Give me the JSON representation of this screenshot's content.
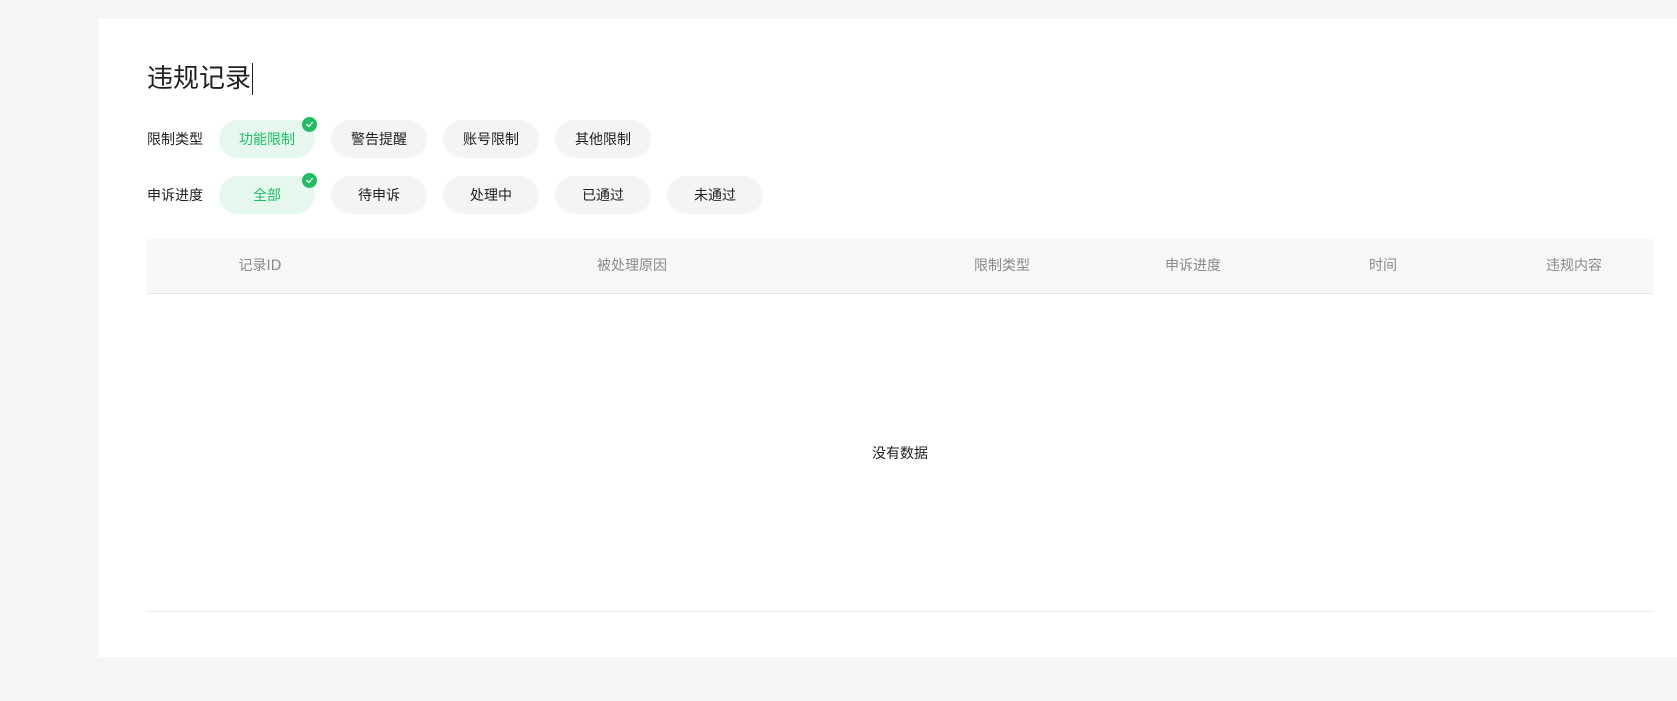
{
  "page": {
    "title": "违规记录"
  },
  "filters": {
    "restriction_type": {
      "label": "限制类型",
      "options": [
        "功能限制",
        "警告提醒",
        "账号限制",
        "其他限制"
      ],
      "selected": "功能限制"
    },
    "appeal_progress": {
      "label": "申诉进度",
      "options": [
        "全部",
        "待申诉",
        "处理中",
        "已通过",
        "未通过"
      ],
      "selected": "全部"
    }
  },
  "table": {
    "columns": [
      "记录ID",
      "被处理原因",
      "限制类型",
      "申诉进度",
      "时间",
      "违规内容"
    ],
    "empty_text": "没有数据",
    "rows": []
  },
  "colors": {
    "accent": "#1fbe63",
    "active_chip_bg": "#e6f7ee",
    "chip_bg": "#f3f4f5",
    "page_bg": "#f5f6f7"
  }
}
